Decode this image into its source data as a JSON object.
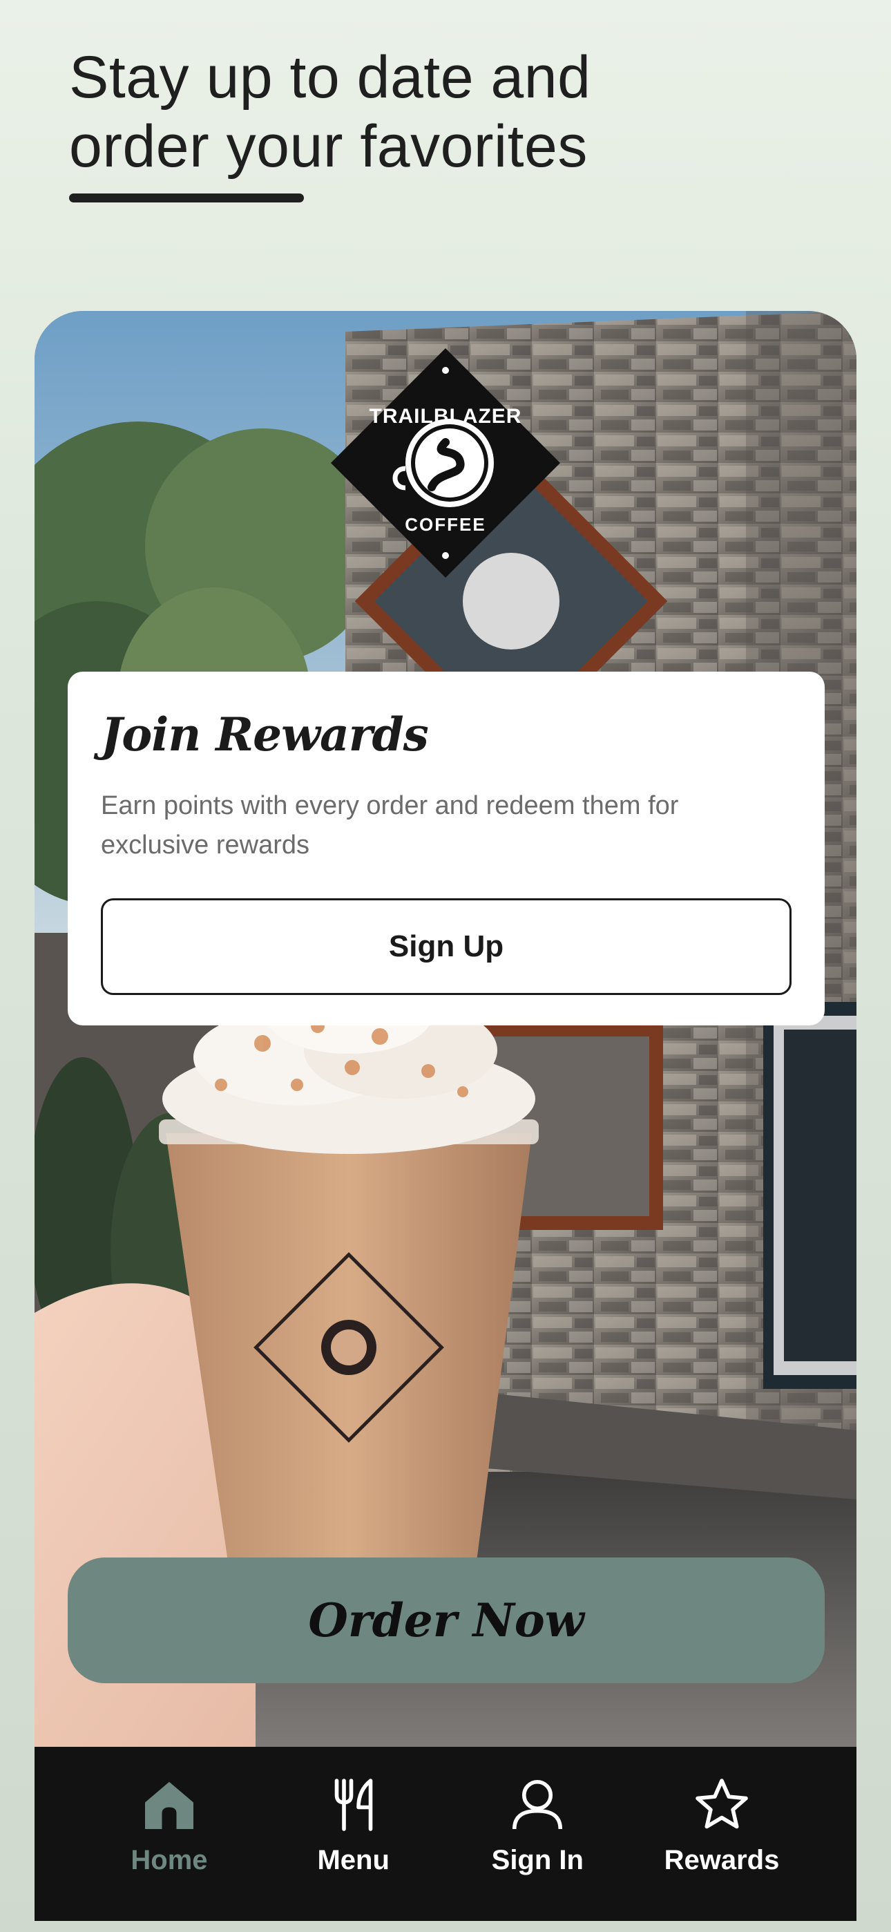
{
  "header": {
    "line1": "Stay up to date and",
    "line2": "order your favorites"
  },
  "brand": {
    "name_top": "TRAILBLAZER",
    "name_bottom": "COFFEE"
  },
  "rewards_card": {
    "title": "Join Rewards",
    "description": "Earn points with every order and redeem them for exclusive rewards",
    "signup_label": "Sign Up"
  },
  "order_button": {
    "label": "Order Now"
  },
  "tabbar": {
    "tabs": [
      {
        "label": "Home",
        "icon": "home-icon",
        "active": true
      },
      {
        "label": "Menu",
        "icon": "fork-knife-icon",
        "active": false
      },
      {
        "label": "Sign In",
        "icon": "user-icon",
        "active": false
      },
      {
        "label": "Rewards",
        "icon": "star-icon",
        "active": false
      }
    ]
  },
  "colors": {
    "accent": "#6e8780",
    "tabbar_bg": "#121212",
    "text_dark": "#1f1f1f",
    "text_muted": "#6b6b6b"
  }
}
